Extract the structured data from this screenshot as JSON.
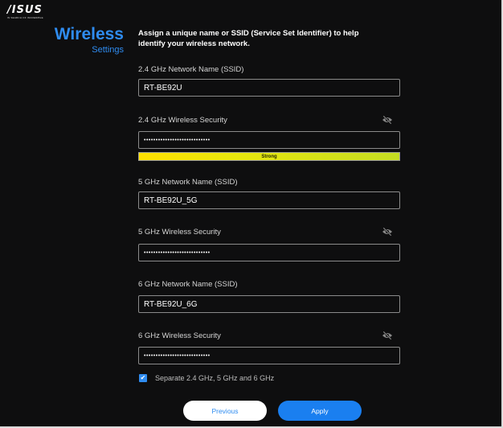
{
  "brand": {
    "logo_text": "/ISUS",
    "tagline": "IN SEARCH OF INCREDIBLE"
  },
  "header": {
    "title": "Wireless",
    "subtitle": "Settings",
    "intro": "Assign a unique name or SSID (Service Set Identifier) to help identify your wireless network."
  },
  "bands": [
    {
      "ssid_label": "2.4 GHz Network Name (SSID)",
      "ssid_value": "RT-BE92U",
      "security_label": "2.4 GHz Wireless Security",
      "password_masked": "••••••••••••••••••••••••••••",
      "visibility_icon": "eye-slash-icon",
      "strength_label": "Strong"
    },
    {
      "ssid_label": "5 GHz Network Name (SSID)",
      "ssid_value": "RT-BE92U_5G",
      "security_label": "5 GHz Wireless Security",
      "password_masked": "••••••••••••••••••••••••••••",
      "visibility_icon": "eye-slash-icon"
    },
    {
      "ssid_label": "6 GHz Network Name (SSID)",
      "ssid_value": "RT-BE92U_6G",
      "security_label": "6 GHz Wireless Security",
      "password_masked": "••••••••••••••••••••••••••••",
      "visibility_icon": "eye-slash-icon"
    }
  ],
  "separate_option": {
    "label": "Separate 2.4 GHz, 5 GHz and 6 GHz",
    "checked": true
  },
  "buttons": {
    "previous": "Previous",
    "apply": "Apply"
  },
  "colors": {
    "accent": "#2f8cf0",
    "background": "#0e0e0f",
    "strength_bar": "#d8e31a"
  }
}
